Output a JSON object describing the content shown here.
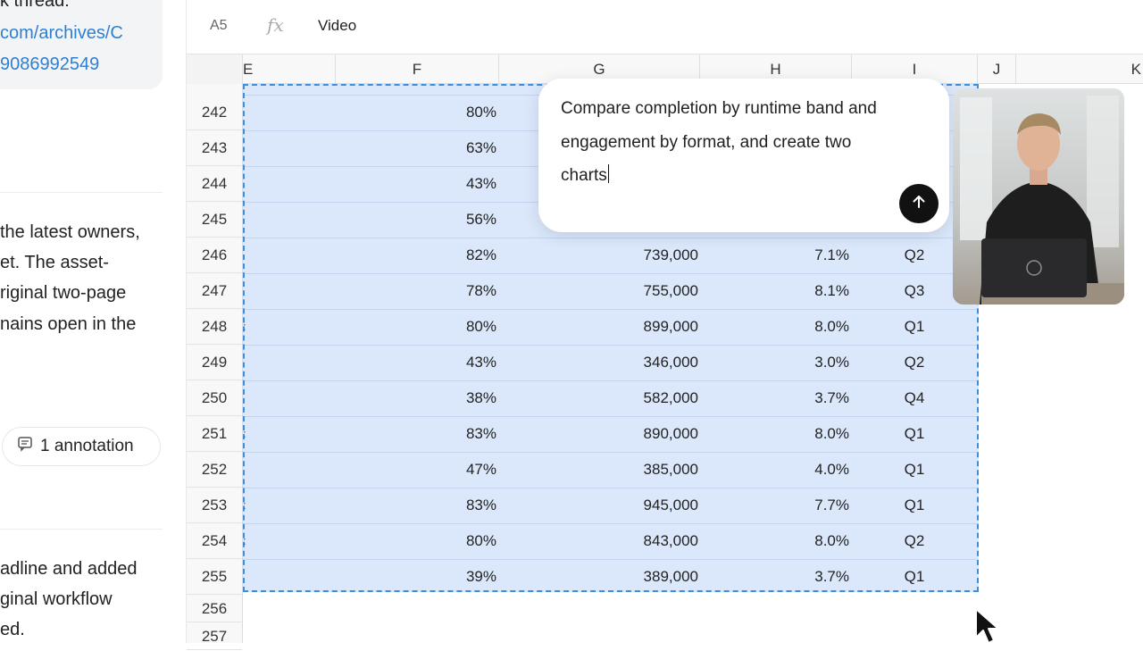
{
  "chat": {
    "lines_a": [
      "k thread:",
      "com/archives/C",
      "9086992549"
    ],
    "lines_b": [
      "the latest owners,",
      "et. The asset-",
      "riginal two-page",
      "nains open in the"
    ],
    "annotation_label": "1 annotation",
    "lines_c": [
      "adline and added",
      "ginal workflow",
      "ed."
    ]
  },
  "formula_bar": {
    "cell_ref": "A5",
    "value": "Video"
  },
  "columns": [
    "E",
    "F",
    "G",
    "H",
    "I",
    "J",
    "K"
  ],
  "rows": [
    {
      "num": "242",
      "f": "80%",
      "g": "",
      "h": "",
      "i": ""
    },
    {
      "num": "243",
      "f": "63%",
      "g": "",
      "h": "",
      "i": ""
    },
    {
      "num": "244",
      "f": "43%",
      "g": "",
      "h": "",
      "i": ""
    },
    {
      "num": "245",
      "f": "56%",
      "g": "",
      "h": "",
      "i": ""
    },
    {
      "num": "246",
      "f": "82%",
      "g": "739,000",
      "h": "7.1%",
      "i": "Q2"
    },
    {
      "num": "247",
      "f": "78%",
      "g": "755,000",
      "h": "8.1%",
      "i": "Q3"
    },
    {
      "num": "248",
      "f": "80%",
      "g": "899,000",
      "h": "8.0%",
      "i": "Q1"
    },
    {
      "num": "249",
      "f": "43%",
      "g": "346,000",
      "h": "3.0%",
      "i": "Q2"
    },
    {
      "num": "250",
      "f": "38%",
      "g": "582,000",
      "h": "3.7%",
      "i": "Q4"
    },
    {
      "num": "251",
      "f": "83%",
      "g": "890,000",
      "h": "8.0%",
      "i": "Q1"
    },
    {
      "num": "252",
      "f": "47%",
      "g": "385,000",
      "h": "4.0%",
      "i": "Q1"
    },
    {
      "num": "253",
      "f": "83%",
      "g": "945,000",
      "h": "7.7%",
      "i": "Q1"
    },
    {
      "num": "254",
      "f": "80%",
      "g": "843,000",
      "h": "8.0%",
      "i": "Q2"
    },
    {
      "num": "255",
      "f": "39%",
      "g": "389,000",
      "h": "3.7%",
      "i": "Q1"
    },
    {
      "num": "256",
      "f": "",
      "g": "",
      "h": "",
      "i": ""
    },
    {
      "num": "257",
      "f": "",
      "g": "",
      "h": "",
      "i": ""
    }
  ],
  "prompt": {
    "text": "Compare completion by runtime band and engagement by format, and create two charts",
    "send_icon": "arrow-up-icon"
  },
  "colors": {
    "selection_fill": "#dbe8fb",
    "selection_border": "#3c8ede",
    "link": "#2f7fd0"
  }
}
